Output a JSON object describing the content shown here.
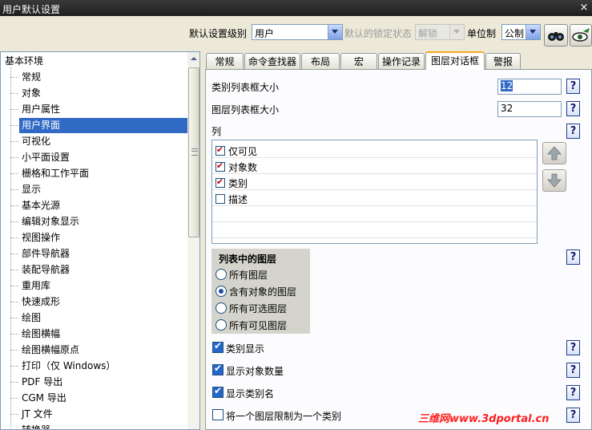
{
  "window": {
    "title": "用户默认设置",
    "close": "×"
  },
  "toolbar": {
    "level_label": "默认设置级别",
    "level_value": "用户",
    "lock_label": "默认的锁定状态",
    "lock_value": "解锁",
    "unit_label": "单位制",
    "unit_value": "公制",
    "buttons": [
      "binoculars-icon",
      "view-icon"
    ]
  },
  "tree": {
    "root": "基本环境",
    "items": [
      "常规",
      "对象",
      "用户属性",
      "用户界面",
      "可视化",
      "小平面设置",
      "栅格和工作平面",
      "显示",
      "基本光源",
      "编辑对象显示",
      "视图操作",
      "部件导航器",
      "装配导航器",
      "重用库",
      "快速成形",
      "绘图",
      "绘图横幅",
      "绘图横幅原点",
      "打印（仅 Windows）",
      "PDF 导出",
      "CGM 导出",
      "JT 文件",
      "转换器"
    ],
    "selected_index": 3
  },
  "tabs": [
    "常规",
    "命令查找器",
    "布局",
    "宏",
    "操作记录",
    "图层对话框",
    "警报"
  ],
  "active_tab": 5,
  "panel": {
    "category_list_label": "类别列表框大小",
    "category_list_value": "12",
    "layer_list_label": "图层列表框大小",
    "layer_list_value": "32",
    "columns_label": "列",
    "columns": [
      {
        "label": "仅可见",
        "checked": true
      },
      {
        "label": "对象数",
        "checked": true
      },
      {
        "label": "类别",
        "checked": true
      },
      {
        "label": "描述",
        "checked": false
      }
    ],
    "layers_group": {
      "title": "列表中的图层",
      "options": [
        "所有图层",
        "含有对象的图层",
        "所有可选图层",
        "所有可见图层"
      ],
      "selected_index": 1
    },
    "checkboxes": [
      {
        "label": "类别显示",
        "checked": true
      },
      {
        "label": "显示对象数量",
        "checked": true
      },
      {
        "label": "显示类别名",
        "checked": true
      },
      {
        "label": "将一个图层限制为一个类别",
        "checked": false
      }
    ],
    "help_glyph": "?"
  },
  "watermark": "三维网www.3dportal.cn"
}
